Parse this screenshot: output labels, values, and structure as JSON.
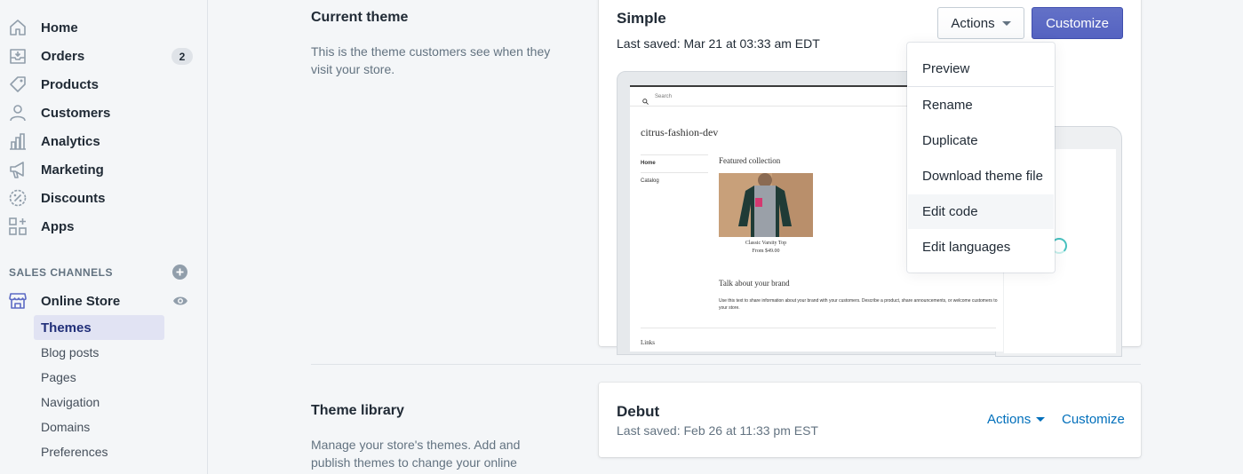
{
  "sidebar": {
    "nav": [
      {
        "label": "Home",
        "icon": "home-icon"
      },
      {
        "label": "Orders",
        "icon": "orders-icon",
        "badge": "2"
      },
      {
        "label": "Products",
        "icon": "tag-icon"
      },
      {
        "label": "Customers",
        "icon": "person-icon"
      },
      {
        "label": "Analytics",
        "icon": "bar-chart-icon"
      },
      {
        "label": "Marketing",
        "icon": "megaphone-icon"
      },
      {
        "label": "Discounts",
        "icon": "discount-icon"
      },
      {
        "label": "Apps",
        "icon": "apps-icon"
      }
    ],
    "sales_channels_title": "SALES CHANNELS",
    "online_store": {
      "label": "Online Store",
      "icon": "store-icon"
    },
    "sub_items": [
      "Themes",
      "Blog posts",
      "Pages",
      "Navigation",
      "Domains",
      "Preferences"
    ],
    "active_sub_item": "Themes"
  },
  "current_theme": {
    "heading": "Current theme",
    "description": "This is the theme customers see when they visit your store.",
    "name": "Simple",
    "last_saved": "Last saved: Mar 21 at 03:33 am EDT",
    "actions_label": "Actions",
    "customize_label": "Customize",
    "dropdown": [
      "Preview",
      "Rename",
      "Duplicate",
      "Download theme file",
      "Edit code",
      "Edit languages"
    ],
    "hovered_item": "Edit code"
  },
  "preview": {
    "search": "Search",
    "store_name": "citrus-fashion-dev",
    "nav": [
      "Home",
      "Catalog"
    ],
    "featured": "Featured collection",
    "product_title": "Classic Varsity Top",
    "product_price": "From $49.00",
    "talk_heading": "Talk about your brand",
    "talk_text": "Use this text to share information about your brand with your customers. Describe a product, share announcements, or welcome customers to your store.",
    "links": "Links"
  },
  "theme_library": {
    "heading": "Theme library",
    "description": "Manage your store's themes. Add and publish themes to change your online",
    "theme_name": "Debut",
    "last_saved": "Last saved: Feb 26 at 11:33 pm EST",
    "actions_label": "Actions",
    "customize_label": "Customize"
  },
  "colors": {
    "primary": "#5c6ac4",
    "link": "#006fbb",
    "active_bg": "#e1e3f3",
    "active_text": "#202e78"
  }
}
